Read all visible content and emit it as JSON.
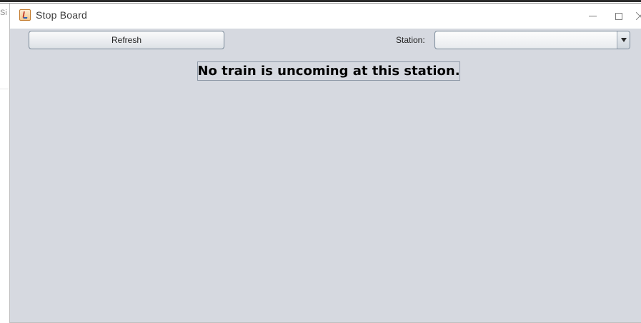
{
  "background": {
    "fragment_text": "Sir"
  },
  "window": {
    "title": "Stop Board",
    "icon": "java-app-icon",
    "controls": [
      "minimize-icon",
      "maximize-icon",
      "close-icon"
    ]
  },
  "toolbar": {
    "refresh_label": "Refresh",
    "station_label": "Station:",
    "station_value": ""
  },
  "main": {
    "message": "No train is uncoming at this station."
  },
  "colors": {
    "content_background": "#d6d9e0",
    "title_background": "#ffffff"
  }
}
